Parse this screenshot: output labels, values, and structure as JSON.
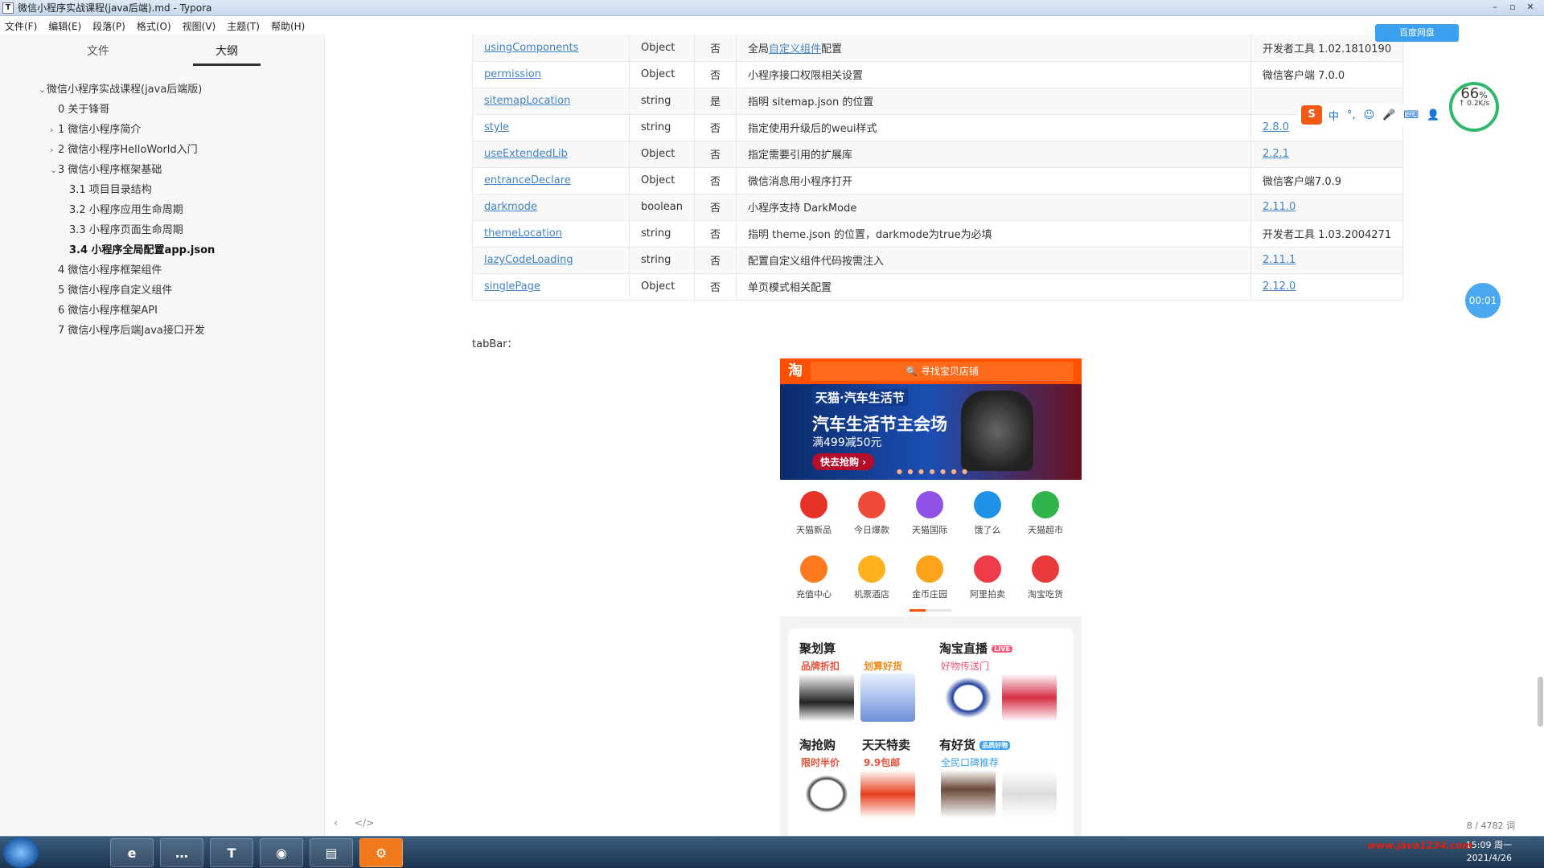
{
  "window": {
    "title": "微信小程序实战课程(java后端).md - Typora",
    "controls": [
      "–",
      "▫",
      "✕"
    ]
  },
  "menu": [
    "文件(F)",
    "编辑(E)",
    "段落(P)",
    "格式(O)",
    "视图(V)",
    "主题(T)",
    "帮助(H)"
  ],
  "sidebar": {
    "tabs": [
      "文件",
      "大纲"
    ],
    "active_tab": "大纲",
    "outline": [
      {
        "chev": "⌄",
        "label": "微信小程序实战课程(java后端版)"
      },
      {
        "chev": "",
        "label": "0 关于锋哥"
      },
      {
        "chev": "›",
        "label": "1 微信小程序简介"
      },
      {
        "chev": "›",
        "label": "2 微信小程序HelloWorld入门"
      },
      {
        "chev": "⌄",
        "label": "3 微信小程序框架基础"
      },
      {
        "chev": "",
        "label": "3.1 项目目录结构"
      },
      {
        "chev": "",
        "label": "3.2 小程序应用生命周期"
      },
      {
        "chev": "",
        "label": "3.3 小程序页面生命周期"
      },
      {
        "chev": "",
        "label": "3.4 小程序全局配置app.json"
      },
      {
        "chev": "",
        "label": "4 微信小程序框架组件"
      },
      {
        "chev": "",
        "label": "5 微信小程序自定义组件"
      },
      {
        "chev": "",
        "label": "6 微信小程序框架API"
      },
      {
        "chev": "",
        "label": "7 微信小程序后端Java接口开发"
      }
    ]
  },
  "table": {
    "rows": [
      {
        "name": "usingComponents",
        "type": "Object",
        "required": "否",
        "desc_pre": "全局",
        "desc_link": "自定义组件",
        "desc_post": "配置",
        "version": "开发者工具 1.02.1810190",
        "version_link": false
      },
      {
        "name": "permission",
        "type": "Object",
        "required": "否",
        "desc_pre": "小程序接口权限相关设置",
        "desc_link": "",
        "desc_post": "",
        "version": "微信客户端 7.0.0",
        "version_link": false
      },
      {
        "name": "sitemapLocation",
        "type": "string",
        "required": "是",
        "desc_pre": "指明 sitemap.json 的位置",
        "desc_link": "",
        "desc_post": "",
        "version": "",
        "version_link": false
      },
      {
        "name": "style",
        "type": "string",
        "required": "否",
        "desc_pre": "指定使用升级后的weui样式",
        "desc_link": "",
        "desc_post": "",
        "version": "2.8.0",
        "version_link": true
      },
      {
        "name": "useExtendedLib",
        "type": "Object",
        "required": "否",
        "desc_pre": "指定需要引用的扩展库",
        "desc_link": "",
        "desc_post": "",
        "version": "2.2.1",
        "version_link": true
      },
      {
        "name": "entranceDeclare",
        "type": "Object",
        "required": "否",
        "desc_pre": "微信消息用小程序打开",
        "desc_link": "",
        "desc_post": "",
        "version": "微信客户端7.0.9",
        "version_link": false
      },
      {
        "name": "darkmode",
        "type": "boolean",
        "required": "否",
        "desc_pre": "小程序支持 DarkMode",
        "desc_link": "",
        "desc_post": "",
        "version": "2.11.0",
        "version_link": true
      },
      {
        "name": "themeLocation",
        "type": "string",
        "required": "否",
        "desc_pre": "指明 theme.json 的位置，darkmode为true为必填",
        "desc_link": "",
        "desc_post": "",
        "version": "开发者工具 1.03.2004271",
        "version_link": false
      },
      {
        "name": "lazyCodeLoading",
        "type": "string",
        "required": "否",
        "desc_pre": "配置自定义组件代码按需注入",
        "desc_link": "",
        "desc_post": "",
        "version": "2.11.1",
        "version_link": true
      },
      {
        "name": "singlePage",
        "type": "Object",
        "required": "否",
        "desc_pre": "单页模式相关配置",
        "desc_link": "",
        "desc_post": "",
        "version": "2.12.0",
        "version_link": true
      }
    ]
  },
  "paragraph": "tabBar：",
  "phone": {
    "logo": "淘",
    "search_placeholder": "寻找宝贝店铺",
    "banner": {
      "tag": "天猫·汽车生活节",
      "headline": "汽车生活节主会场",
      "offer": "满499减50元",
      "cta": "快去抢购 ›"
    },
    "icons": [
      {
        "label": "天猫新品",
        "color": "#e8332a"
      },
      {
        "label": "今日爆款",
        "color": "#f04b3a"
      },
      {
        "label": "天猫国际",
        "color": "#8e52e6"
      },
      {
        "label": "饿了么",
        "color": "#1e93e8"
      },
      {
        "label": "天猫超市",
        "color": "#2fb54c"
      },
      {
        "label": "充值中心",
        "color": "#ff7a1e"
      },
      {
        "label": "机票酒店",
        "color": "#ffb21e"
      },
      {
        "label": "金币庄园",
        "color": "#ffa41a"
      },
      {
        "label": "阿里拍卖",
        "color": "#ee3b4a"
      },
      {
        "label": "淘宝吃货",
        "color": "#e83a3a"
      }
    ],
    "cards": {
      "juhuasuan": "聚划算",
      "brand_discount": "品牌折扣",
      "deal": "划算好货",
      "taobao_live": "淘宝直播",
      "live_badge": "LIVE",
      "live_sub": "好物传送门",
      "taoqianggou": "淘抢购",
      "half_price": "限时半价",
      "tiantian": "天天特卖",
      "nine": "9.9包邮",
      "youhaohuo": "有好货",
      "youhaohuo_badge": "品质好物",
      "youhaohuo_sub": "全民口碑推荐"
    }
  },
  "status": {
    "nav_left": "‹",
    "nav_code": "</>",
    "word_count": "8 / 4782 词"
  },
  "overlays": {
    "speed_percent": "66",
    "speed_unit": "%",
    "speed_rate": "↑ 0.2K/s",
    "timer": "00:01",
    "ime_items": [
      "中",
      "°,",
      "☺",
      "🎤",
      "⌨",
      "👤"
    ],
    "cloud_button": "百度网盘"
  },
  "taskbar": {
    "apps": [
      "e",
      "…",
      "T",
      "◉",
      "▤",
      "⚙"
    ],
    "time": "15:09 周一",
    "date": "2021/4/26",
    "watermark": "www.java1234.com"
  }
}
